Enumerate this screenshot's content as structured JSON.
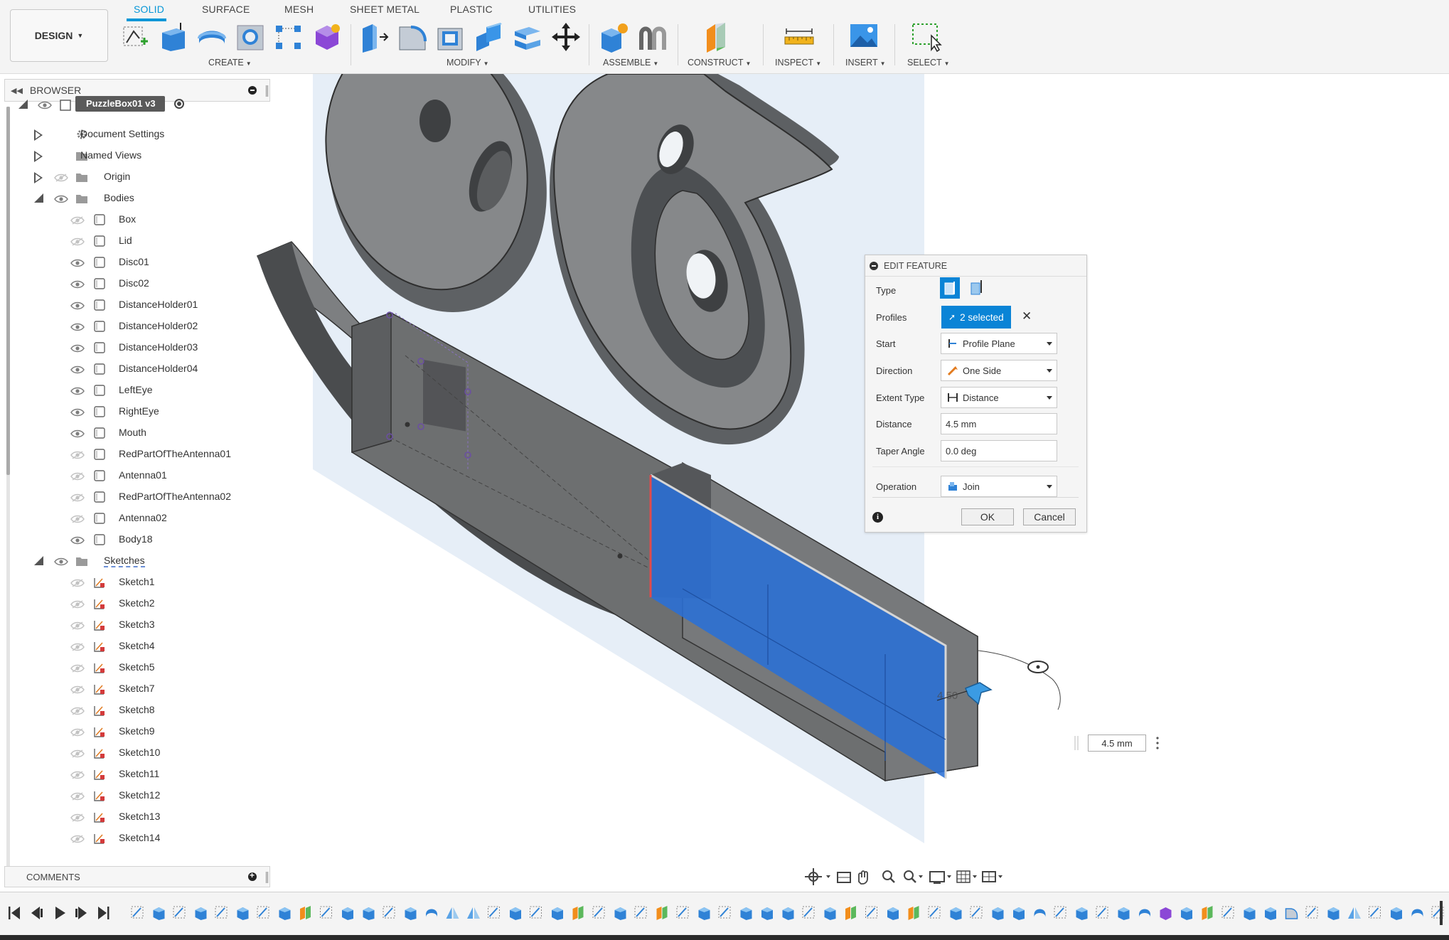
{
  "toolbar": {
    "workspace": "DESIGN",
    "tabs": [
      "SOLID",
      "SURFACE",
      "MESH",
      "SHEET METAL",
      "PLASTIC",
      "UTILITIES"
    ],
    "active_tab": "SOLID",
    "groups": [
      "CREATE",
      "MODIFY",
      "ASSEMBLE",
      "CONSTRUCT",
      "INSPECT",
      "INSERT",
      "SELECT"
    ],
    "create_tools": [
      "create-sketch-icon",
      "extrude-icon",
      "revolve-icon",
      "hole-icon",
      "pattern-icon",
      "form-icon"
    ],
    "modify_tools": [
      "press-pull-icon",
      "fillet-icon",
      "shell-icon",
      "combine-icon",
      "split-body-icon",
      "move-icon"
    ],
    "accent": "#0696d7"
  },
  "browser": {
    "title": "BROWSER",
    "root": "PuzzleBox01 v3",
    "folders": [
      "Document Settings",
      "Named Views",
      "Origin",
      "Bodies"
    ],
    "bodies": [
      {
        "name": "Box",
        "visible": false
      },
      {
        "name": "Lid",
        "visible": false
      },
      {
        "name": "Disc01",
        "visible": true
      },
      {
        "name": "Disc02",
        "visible": true
      },
      {
        "name": "DistanceHolder01",
        "visible": true
      },
      {
        "name": "DistanceHolder02",
        "visible": true
      },
      {
        "name": "DistanceHolder03",
        "visible": true
      },
      {
        "name": "DistanceHolder04",
        "visible": true
      },
      {
        "name": "LeftEye",
        "visible": true
      },
      {
        "name": "RightEye",
        "visible": true
      },
      {
        "name": "Mouth",
        "visible": true
      },
      {
        "name": "RedPartOfTheAntenna01",
        "visible": false
      },
      {
        "name": "Antenna01",
        "visible": false
      },
      {
        "name": "RedPartOfTheAntenna02",
        "visible": false
      },
      {
        "name": "Antenna02",
        "visible": false
      },
      {
        "name": "Body18",
        "visible": true
      }
    ],
    "sketches_label": "Sketches",
    "sketches": [
      "Sketch1",
      "Sketch2",
      "Sketch3",
      "Sketch4",
      "Sketch5",
      "Sketch7",
      "Sketch8",
      "Sketch9",
      "Sketch10",
      "Sketch11",
      "Sketch12",
      "Sketch13",
      "Sketch14"
    ]
  },
  "comments": {
    "title": "COMMENTS"
  },
  "edit_feature": {
    "title": "EDIT FEATURE",
    "type_label": "Type",
    "profiles_label": "Profiles",
    "profiles_value": "2 selected",
    "start_label": "Start",
    "start_value": "Profile Plane",
    "direction_label": "Direction",
    "direction_value": "One Side",
    "extent_label": "Extent Type",
    "extent_value": "Distance",
    "distance_label": "Distance",
    "distance_value": "4.5 mm",
    "taper_label": "Taper Angle",
    "taper_value": "0.0 deg",
    "operation_label": "Operation",
    "operation_value": "Join",
    "ok": "OK",
    "cancel": "Cancel"
  },
  "canvas": {
    "dimension_input": "4.5 mm",
    "dimension_label": "4.50",
    "selection_color": "#2a6fd6"
  }
}
